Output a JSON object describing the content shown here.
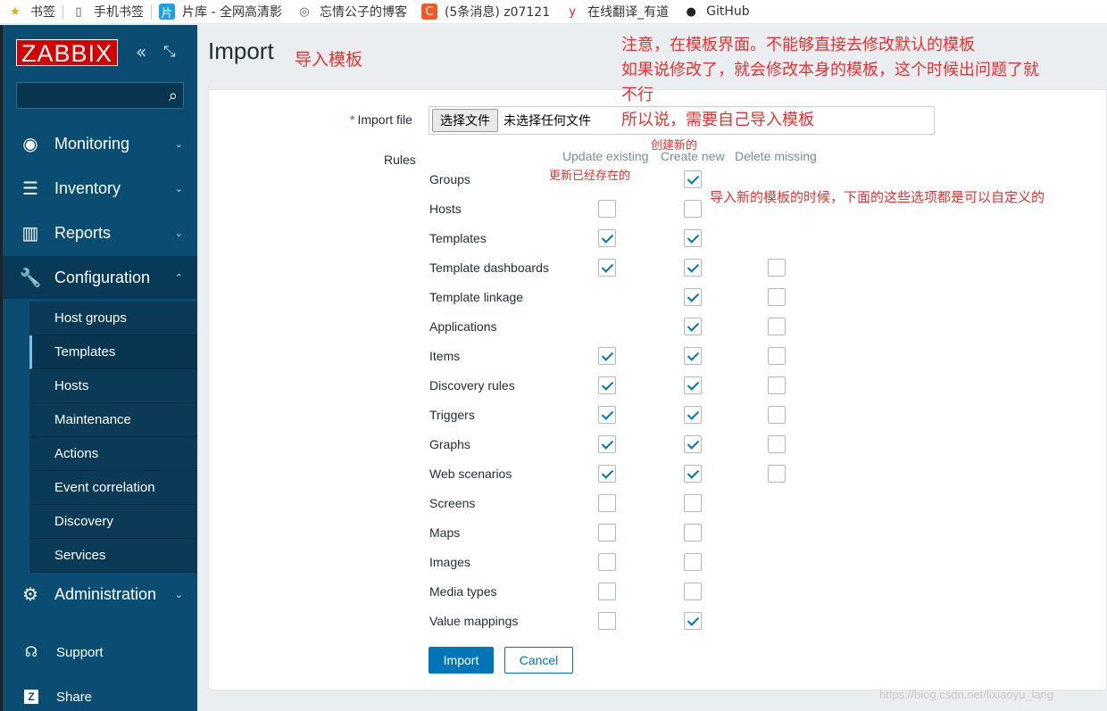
{
  "bookmarks": [
    {
      "label": "书签",
      "icon": "star-icon",
      "color": "#f2a600"
    },
    {
      "label": "手机书签",
      "icon": "phone-icon",
      "color": "#444444"
    },
    {
      "label": "片库 - 全网高清影",
      "icon": "pianku-icon",
      "color": "#1aa0e6"
    },
    {
      "label": "忘情公子的博客",
      "icon": "globe-icon",
      "color": "#555555"
    },
    {
      "label": "(5条消息) z07121",
      "icon": "csdn-icon",
      "color": "#f05a28"
    },
    {
      "label": "在线翻译_有道",
      "icon": "youdao-icon",
      "color": "#e8112d"
    },
    {
      "label": "GitHub",
      "icon": "github-icon",
      "color": "#222222"
    }
  ],
  "sidebar": {
    "logo": "ZABBIX",
    "collapse_icon": "collapse-icon",
    "kiosk_icon": "kiosk-icon",
    "search_placeholder": "",
    "menu": [
      {
        "label": "Monitoring",
        "icon": "eye-icon"
      },
      {
        "label": "Inventory",
        "icon": "list-icon"
      },
      {
        "label": "Reports",
        "icon": "chart-icon"
      },
      {
        "label": "Configuration",
        "icon": "wrench-icon"
      },
      {
        "label": "Administration",
        "icon": "gear-icon"
      }
    ],
    "config_sub": [
      "Host groups",
      "Templates",
      "Hosts",
      "Maintenance",
      "Actions",
      "Event correlation",
      "Discovery",
      "Services"
    ],
    "support": "Support",
    "share": "Share"
  },
  "page": {
    "title": "Import",
    "import_file_label": "Import file",
    "choose_file": "选择文件",
    "no_file": "未选择任何文件",
    "rules_label": "Rules",
    "col_update": "Update existing",
    "col_create": "Create new",
    "col_delete": "Delete missing",
    "import_button": "Import",
    "cancel_button": "Cancel"
  },
  "rules": [
    {
      "name": "Groups",
      "update": null,
      "create": true,
      "delete": null
    },
    {
      "name": "Hosts",
      "update": false,
      "create": false,
      "delete": null
    },
    {
      "name": "Templates",
      "update": true,
      "create": true,
      "delete": null
    },
    {
      "name": "Template dashboards",
      "update": true,
      "create": true,
      "delete": false
    },
    {
      "name": "Template linkage",
      "update": null,
      "create": true,
      "delete": false
    },
    {
      "name": "Applications",
      "update": null,
      "create": true,
      "delete": false
    },
    {
      "name": "Items",
      "update": true,
      "create": true,
      "delete": false
    },
    {
      "name": "Discovery rules",
      "update": true,
      "create": true,
      "delete": false
    },
    {
      "name": "Triggers",
      "update": true,
      "create": true,
      "delete": false
    },
    {
      "name": "Graphs",
      "update": true,
      "create": true,
      "delete": false
    },
    {
      "name": "Web scenarios",
      "update": true,
      "create": true,
      "delete": false
    },
    {
      "name": "Screens",
      "update": false,
      "create": false,
      "delete": null
    },
    {
      "name": "Maps",
      "update": false,
      "create": false,
      "delete": null
    },
    {
      "name": "Images",
      "update": false,
      "create": false,
      "delete": null
    },
    {
      "name": "Media types",
      "update": false,
      "create": false,
      "delete": null
    },
    {
      "name": "Value mappings",
      "update": false,
      "create": true,
      "delete": null
    }
  ],
  "annotations": {
    "title_note": "导入模板",
    "note_line1": "注意，在模板界面。不能够直接去修改默认的模板",
    "note_line2": "如果说修改了，就会修改本身的模板，这个时候出问题了就",
    "note_line3": "不行",
    "note_line4": "所以说，需要自己导入模板",
    "create_note": "创建新的",
    "update_note": "更新已经存在的",
    "custom_note": "导入新的模板的时候，下面的这些选项都是可以自定义的"
  },
  "watermark": "https://blog.csdn.net/lixiaoyu_lang",
  "colors": {
    "sidebar": "#0b4d72",
    "accent": "#0275b8",
    "annotation": "#e33232",
    "logo": "#d40000"
  }
}
